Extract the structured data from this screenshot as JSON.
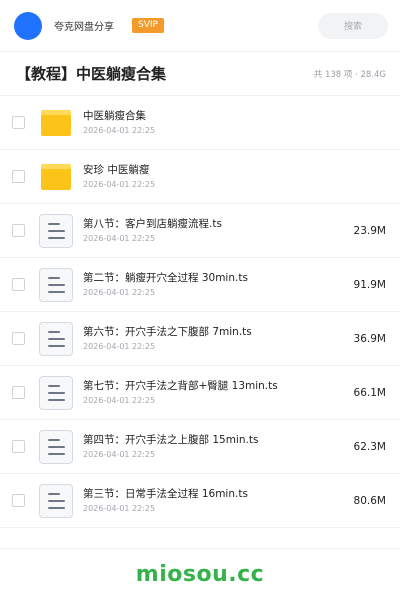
{
  "topbar": {
    "app_name": "夸克网盘分享",
    "vip_label": "SVIP",
    "search_placeholder": "搜索"
  },
  "header": {
    "title": "【教程】中医躺瘦合集",
    "meta": "共 138 项 · 28.4G"
  },
  "items": [
    {
      "type": "folder",
      "name": "中医躺瘦合集",
      "date": "2026-04-01 22:25",
      "size": ""
    },
    {
      "type": "folder",
      "name": "安珍  中医躺瘦",
      "date": "2026-04-01 22:25",
      "size": ""
    },
    {
      "type": "file",
      "name": "第八节：客户到店躺瘦流程.ts",
      "date": "2026-04-01 22:25",
      "size": "23.9M"
    },
    {
      "type": "file",
      "name": "第二节：躺瘦开穴全过程 30min.ts",
      "date": "2026-04-01 22:25",
      "size": "91.9M"
    },
    {
      "type": "file",
      "name": "第六节：开穴手法之下腹部 7min.ts",
      "date": "2026-04-01 22:25",
      "size": "36.9M"
    },
    {
      "type": "file",
      "name": "第七节：开穴手法之背部+臀腿 13min.ts",
      "date": "2026-04-01 22:25",
      "size": "66.1M"
    },
    {
      "type": "file",
      "name": "第四节：开穴手法之上腹部 15min.ts",
      "date": "2026-04-01 22:25",
      "size": "62.3M"
    },
    {
      "type": "file",
      "name": "第三节：日常手法全过程 16min.ts",
      "date": "2026-04-01 22:25",
      "size": "80.6M"
    }
  ],
  "watermark": "miosou.cc",
  "colors": {
    "accent_blue": "#1f73ff",
    "vip_orange": "#f39a2b",
    "folder_yellow": "#fcc419",
    "watermark_green": "#36b24a"
  }
}
